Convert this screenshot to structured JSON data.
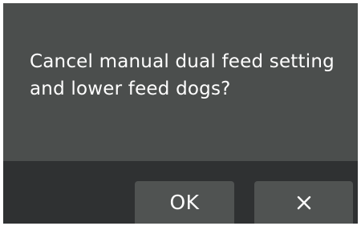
{
  "dialog": {
    "message": "Cancel manual dual feed setting\nand lower feed dogs?",
    "ok_label": "OK",
    "cancel_icon": "close-icon"
  },
  "colors": {
    "message_background": "#4b4e4d",
    "button_bar_background": "#2f3132",
    "button_background": "#505352",
    "text": "#ffffff"
  }
}
